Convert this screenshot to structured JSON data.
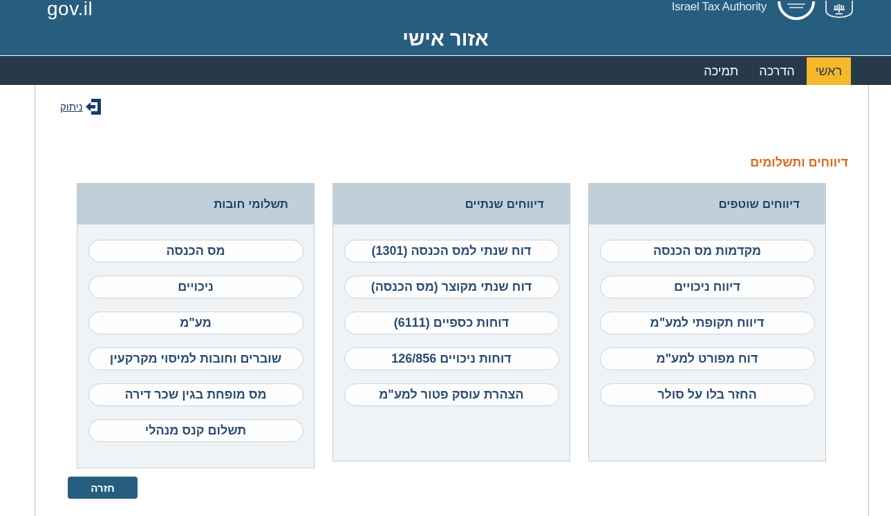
{
  "header": {
    "logo_text": "gov.il",
    "authority_name": "Israel Tax Authority",
    "title": "אזור אישי"
  },
  "nav": [
    {
      "label": "ראשי",
      "selected": true
    },
    {
      "label": "הדרכה",
      "selected": false
    },
    {
      "label": "תמיכה",
      "selected": false
    }
  ],
  "logout_link": "ניתוק",
  "section_title": "דיווחים ותשלומים",
  "panels": [
    {
      "title": "דיווחים שוטפים",
      "buttons": [
        "מקדמות מס הכנסה",
        "דיווח ניכויים",
        "דיווח תקופתי למע\"מ",
        "דוח מפורט למע\"מ",
        "החזר בלו על סולר"
      ]
    },
    {
      "title": "דיווחים שנתיים",
      "buttons": [
        "דוח שנתי למס הכנסה (1301)",
        "דוח שנתי מקוצר (מס הכנסה)",
        "דוחות כספיים (6111)",
        "דוחות ניכויים 126/856",
        "הצהרת עוסק פטור למע\"מ"
      ]
    },
    {
      "title": "תשלומי חובות",
      "buttons": [
        "מס הכנסה",
        "ניכויים",
        "מע\"מ",
        "שוברים וחובות למיסוי מקרקעין",
        "מס מופחת בגין שכר דירה",
        "תשלום קנס מנהלי"
      ]
    }
  ],
  "back_button": "חזרה"
}
